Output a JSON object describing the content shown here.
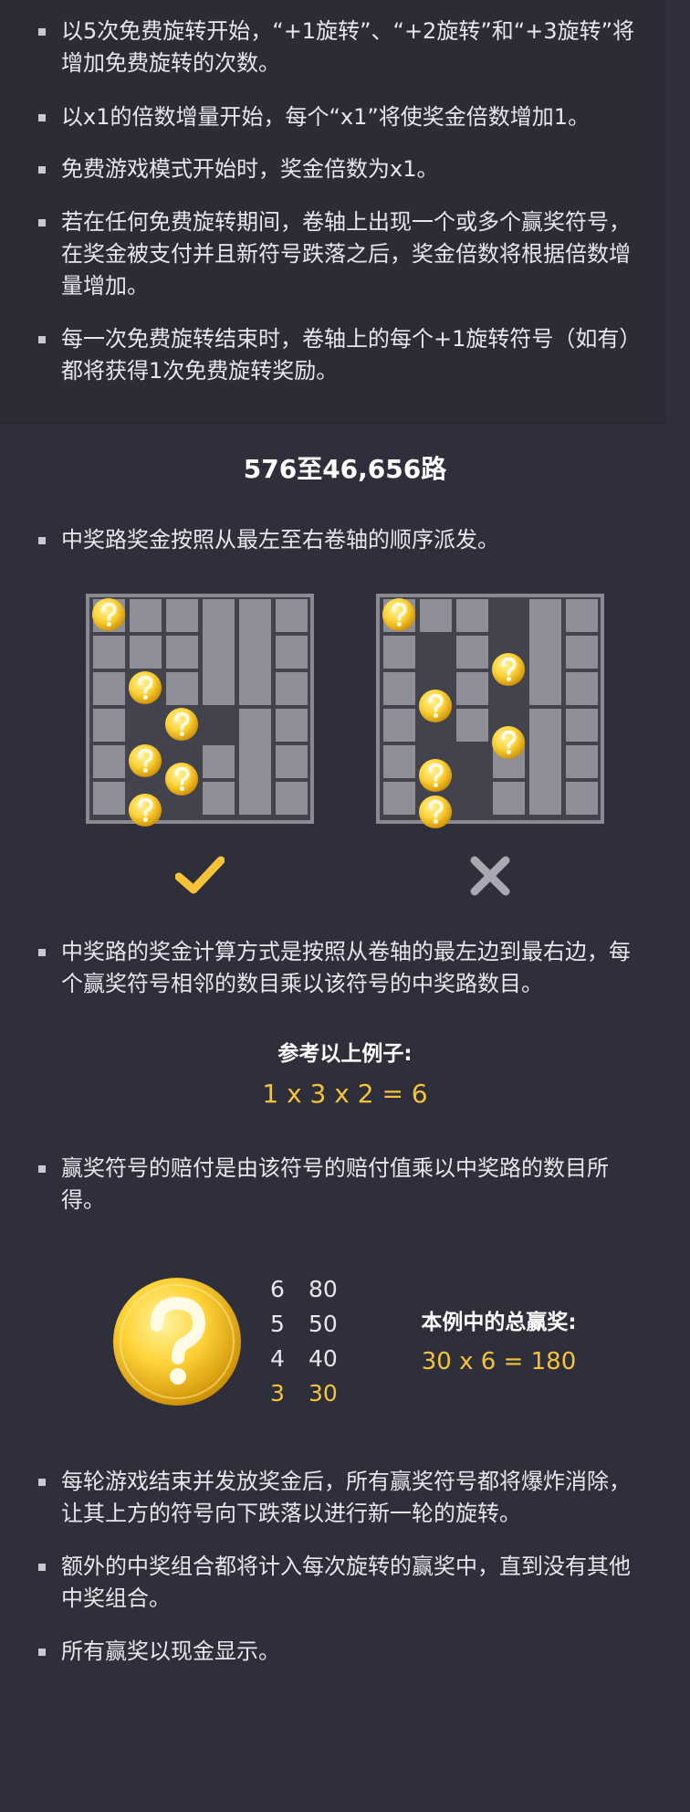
{
  "free_spin_rules": [
    "以5次免费旋转开始，“+1旋转”、“+2旋转”和“+3旋转”将增加免费旋转的次数。",
    "以x1的倍数增量开始，每个“x1”将使奖金倍数增加1。",
    "免费游戏模式开始时，奖金倍数为x1。",
    "若在任何免费旋转期间，卷轴上出现一个或多个赢奖符号，在奖金被支付并且新符号跌落之后，奖金倍数将根据倍数增量增加。",
    "每一次免费旋转结束时，卷轴上的每个+1旋转符号（如有）都将获得1次免费旋转奖励。"
  ],
  "ways_section": {
    "heading": "576至46,656路",
    "rule_order": "中奖路奖金按照从最左至右卷轴的顺序派发。",
    "example_valid": {
      "result": "check-icon",
      "color": "#f6c338"
    },
    "example_invalid": {
      "result": "cross-icon",
      "color": "#a8a8b0"
    },
    "rule_calc": "中奖路的奖金计算方式是按照从卷轴的最左边到最右边，每个赢奖符号相邻的数目乘以该符号的中奖路数目。",
    "example_label": "参考以上例子:",
    "example_formula": "1 x 3 x 2 = 6",
    "rule_payout": "赢奖符号的赔付是由该符号的赔付值乘以中奖路的数目所得。",
    "symbol_icon": "question-coin-icon",
    "paytable": [
      {
        "count": "6",
        "value": "80"
      },
      {
        "count": "5",
        "value": "50"
      },
      {
        "count": "4",
        "value": "40"
      },
      {
        "count": "3",
        "value": "30",
        "highlight": true
      }
    ],
    "total_label": "本例中的总赢奖:",
    "total_formula": "30 x 6 = 180",
    "closing_rules": [
      "每轮游戏结束并发放奖金后，所有赢奖符号都将爆炸消除，让其上方的符号向下跌落以进行新一轮的旋转。",
      "额外的中奖组合都将计入每次旋转的赢奖中，直到没有其他中奖组合。",
      "所有赢奖以现金显示。"
    ]
  },
  "colors": {
    "accent": "#f6c338",
    "background": "#2f2f3b",
    "text": "#e6e6ec"
  }
}
